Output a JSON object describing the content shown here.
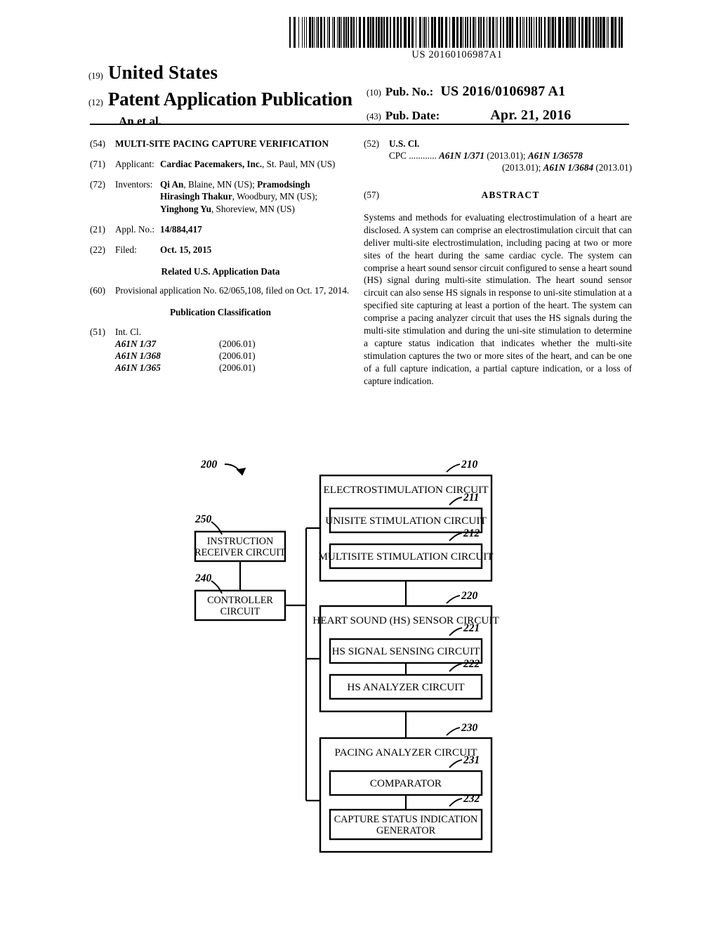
{
  "barcode": {
    "number": "US 20160106987A1"
  },
  "masthead": {
    "code19": "(19)",
    "country": "United States",
    "code12": "(12)",
    "doc_type": "Patent Application Publication",
    "inventor_line": "An et al.",
    "code10": "(10)",
    "pub_no_label": "Pub. No.:",
    "pub_no_value": "US 2016/0106987 A1",
    "code43": "(43)",
    "pub_date_label": "Pub. Date:",
    "pub_date_value": "Apr. 21, 2016"
  },
  "left_column": {
    "title": {
      "code": "(54)",
      "text": "MULTI-SITE PACING CAPTURE VERIFICATION"
    },
    "applicant": {
      "code": "(71)",
      "label": "Applicant:",
      "name": "Cardiac Pacemakers, Inc.",
      "rest": ", St. Paul, MN (US)"
    },
    "inventors": {
      "code": "(72)",
      "label": "Inventors:",
      "name1": "Qi An",
      "rest1": ", Blaine, MN (US); ",
      "name2": "Pramodsingh Hirasingh Thakur",
      "rest2": ", Woodbury, MN (US); ",
      "name3": "Yinghong Yu",
      "rest3": ", Shoreview, MN (US)"
    },
    "appl_no": {
      "code": "(21)",
      "label": "Appl. No.:",
      "value": "14/884,417"
    },
    "filed": {
      "code": "(22)",
      "label": "Filed:",
      "value": "Oct. 15, 2015"
    },
    "related_heading": "Related U.S. Application Data",
    "related": {
      "code": "(60)",
      "text": "Provisional application No. 62/065,108, filed on Oct. 17, 2014."
    },
    "pub_class_heading": "Publication Classification",
    "int_cl": {
      "code": "(51)",
      "heading": "Int. Cl.",
      "rows": [
        {
          "code": "A61N 1/37",
          "version": "(2006.01)"
        },
        {
          "code": "A61N 1/368",
          "version": "(2006.01)"
        },
        {
          "code": "A61N 1/365",
          "version": "(2006.01)"
        }
      ]
    }
  },
  "right_column": {
    "us_cl": {
      "code": "(52)",
      "heading": "U.S. Cl.",
      "cpc_label": "CPC",
      "dots": "............",
      "cpc_1": "A61N 1/371",
      "cpc_1_ver": " (2013.01); ",
      "cpc_2": "A61N 1/36578",
      "cpc_2_ver": "(2013.01); ",
      "cpc_3": "A61N 1/3684",
      "cpc_3_ver": " (2013.01)"
    },
    "abstract": {
      "code": "(57)",
      "heading": "ABSTRACT",
      "text": "Systems and methods for evaluating electrostimulation of a heart are disclosed. A system can comprise an electrostimulation circuit that can deliver multi-site electrostimulation, including pacing at two or more sites of the heart during the same cardiac cycle. The system can comprise a heart sound sensor circuit configured to sense a heart sound (HS) signal during multi-site stimulation. The heart sound sensor circuit can also sense HS signals in response to uni-site stimulation at a specified site capturing at least a portion of the heart. The system can comprise a pacing analyzer circuit that uses the HS signals during the multi-site stimulation and during the uni-site stimulation to determine a capture status indication that indicates whether the multi-site stimulation captures the two or more sites of the heart, and can be one of a full capture indication, a partial capture indication, or a loss of capture indication."
    }
  },
  "figure": {
    "system_ref": "200",
    "blocks": {
      "electrostimulation": {
        "ref": "210",
        "label": "ELECTROSTIMULATION CIRCUIT"
      },
      "unisite": {
        "ref": "211",
        "label": "UNISITE STIMULATION CIRCUIT"
      },
      "multisite": {
        "ref": "212",
        "label": "MULTISITE STIMULATION CIRCUIT"
      },
      "hs_sensor": {
        "ref": "220",
        "label": "HEART SOUND (HS) SENSOR CIRCUIT"
      },
      "hs_signal_sensing": {
        "ref": "221",
        "label": "HS SIGNAL SENSING CIRCUIT"
      },
      "hs_analyzer": {
        "ref": "222",
        "label": "HS ANALYZER CIRCUIT"
      },
      "pacing_analyzer": {
        "ref": "230",
        "label": "PACING ANALYZER CIRCUIT"
      },
      "comparator": {
        "ref": "231",
        "label": "COMPARATOR"
      },
      "capture_status": {
        "ref": "232",
        "label1": "CAPTURE STATUS INDICATION",
        "label2": "GENERATOR"
      },
      "controller": {
        "ref": "240",
        "label1": "CONTROLLER",
        "label2": "CIRCUIT"
      },
      "instruction_receiver": {
        "ref": "250",
        "label1": "INSTRUCTION",
        "label2": "RECEIVER CIRCUIT"
      }
    }
  }
}
